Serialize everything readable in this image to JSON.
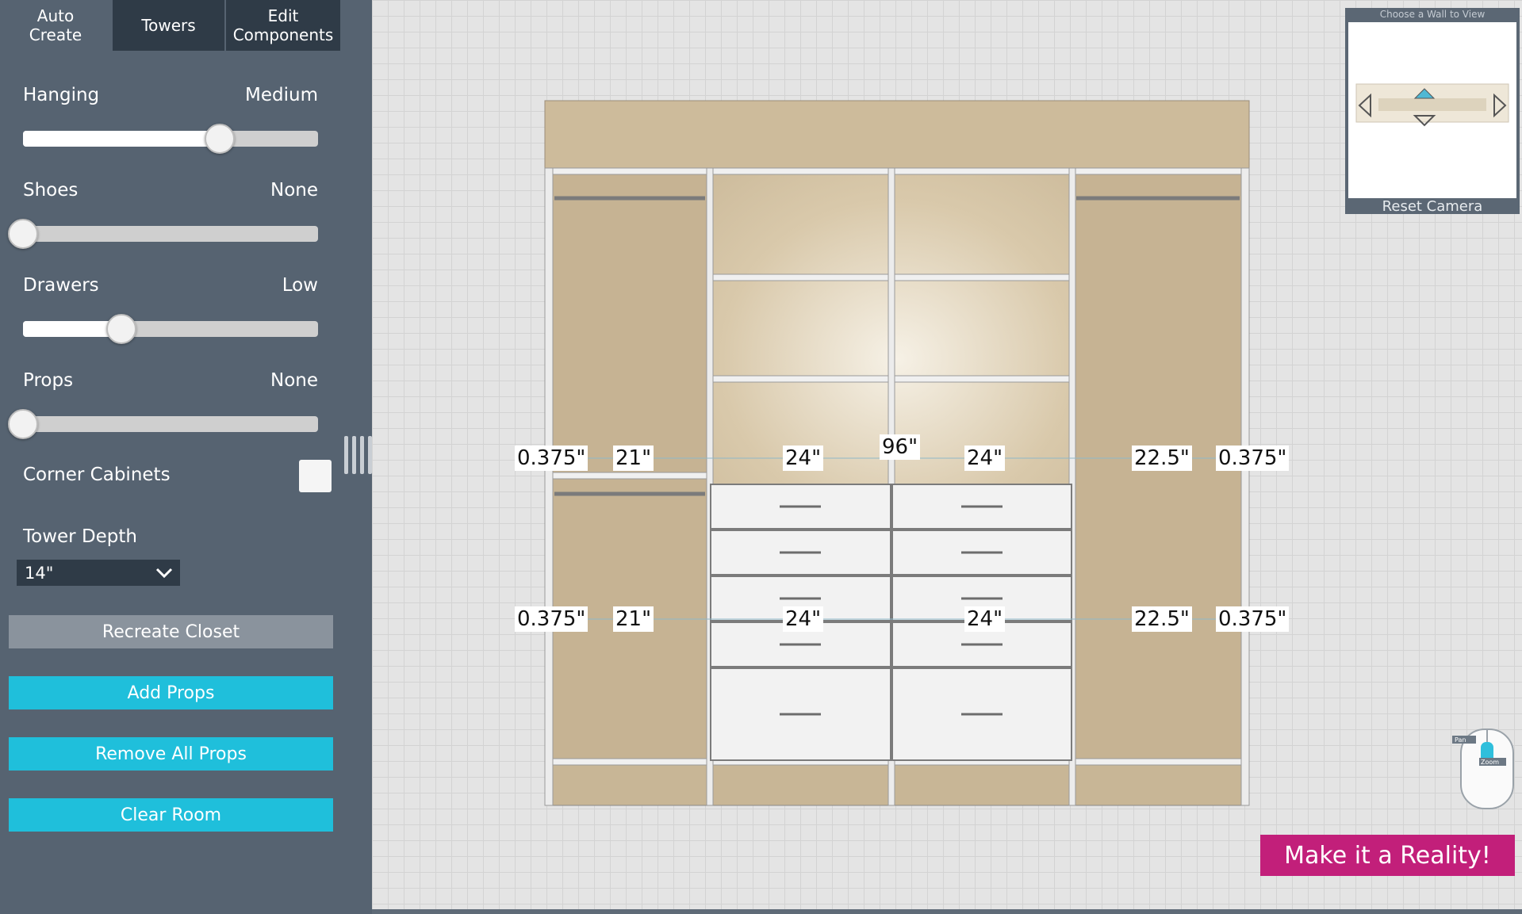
{
  "tabs": [
    {
      "label": "Auto\nCreate"
    },
    {
      "label": "Towers"
    },
    {
      "label": "Edit\nComponents"
    }
  ],
  "sliders": [
    {
      "label": "Hanging",
      "value_text": "Medium",
      "fraction": 0.667
    },
    {
      "label": "Shoes",
      "value_text": "None",
      "fraction": 0.0
    },
    {
      "label": "Drawers",
      "value_text": "Low",
      "fraction": 0.333
    },
    {
      "label": "Props",
      "value_text": "None",
      "fraction": 0.0
    }
  ],
  "corner_cabinets": {
    "label": "Corner Cabinets",
    "checked": false
  },
  "tower_depth": {
    "label": "Tower Depth",
    "value": "14\""
  },
  "buttons": {
    "recreate": "Recreate Closet",
    "add_props": "Add Props",
    "remove_props": "Remove All Props",
    "clear_room": "Clear Room"
  },
  "dimensions": {
    "total": "96\"",
    "row1": [
      "0.375\"",
      "21\"",
      "24\"",
      "24\"",
      "22.5\"",
      "0.375\""
    ],
    "row2": [
      "0.375\"",
      "21\"",
      "24\"",
      "24\"",
      "22.5\"",
      "0.375\""
    ]
  },
  "navigator": {
    "title": "Choose a Wall to View",
    "reset": "Reset Camera"
  },
  "mouse_hint": {
    "pan": "Pan",
    "zoom": "Zoom"
  },
  "cta": "Make it a Reality!",
  "colors": {
    "sidebar": "#566371",
    "tab_dark": "#2f3b47",
    "accent_cyan": "#1fbfdb",
    "cta_magenta": "#c21f7a",
    "closet_wood": "#c9b79a"
  }
}
